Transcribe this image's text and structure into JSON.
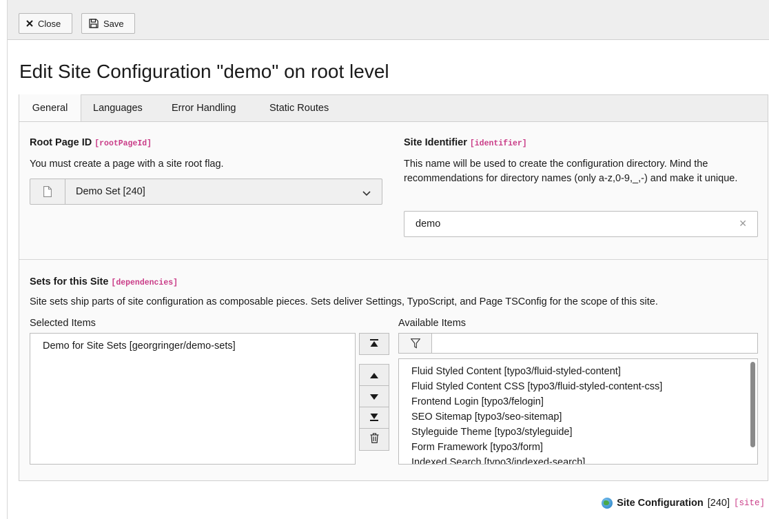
{
  "toolbar": {
    "close_label": "Close",
    "save_label": "Save"
  },
  "page_title": "Edit Site Configuration \"demo\" on root level",
  "tabs": [
    {
      "label": "General",
      "active": true
    },
    {
      "label": "Languages",
      "active": false
    },
    {
      "label": "Error Handling",
      "active": false
    },
    {
      "label": "Static Routes",
      "active": false
    }
  ],
  "root_page": {
    "label": "Root Page ID",
    "code": "[rootPageId]",
    "description": "You must create a page with a site root flag.",
    "selected_value": "Demo Set [240]"
  },
  "site_identifier": {
    "label": "Site Identifier",
    "code": "[identifier]",
    "description": "This name will be used to create the configuration directory. Mind the recommendations for directory names (only a-z,0-9,_,-) and make it unique.",
    "value": "demo"
  },
  "sets": {
    "label": "Sets for this Site",
    "code": "[dependencies]",
    "description": "Site sets ship parts of site configuration as composable pieces. Sets deliver Settings, TypoScript, and Page TSConfig for the scope of this site.",
    "selected_label": "Selected Items",
    "available_label": "Available Items",
    "selected_items": [
      "Demo for Site Sets [georgringer/demo-sets]"
    ],
    "available_items": [
      "Fluid Styled Content [typo3/fluid-styled-content]",
      "Fluid Styled Content CSS [typo3/fluid-styled-content-css]",
      "Frontend Login [typo3/felogin]",
      "SEO Sitemap [typo3/seo-sitemap]",
      "Styleguide Theme [typo3/styleguide]",
      "Form Framework [typo3/form]",
      "Indexed Search [typo3/indexed-search]"
    ]
  },
  "footer": {
    "record_type": "Site Configuration",
    "record_id": "[240]",
    "table": "[site]"
  },
  "colors": {
    "code_accent": "#c93b87",
    "panel_bg": "#fafafa",
    "toolbar_bg": "#eeeeee"
  }
}
